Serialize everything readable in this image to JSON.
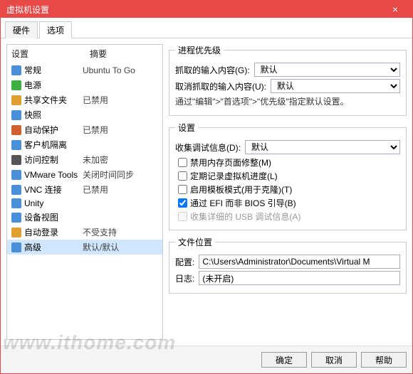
{
  "title": "虚拟机设置",
  "tabs": {
    "hardware": "硬件",
    "options": "选项"
  },
  "left": {
    "col1": "设置",
    "col2": "摘要",
    "items": [
      {
        "name": "常规",
        "summary": "Ubuntu To Go",
        "color": "#4a90d9"
      },
      {
        "name": "电源",
        "summary": "",
        "color": "#3cb043"
      },
      {
        "name": "共享文件夹",
        "summary": "已禁用",
        "color": "#e0a030"
      },
      {
        "name": "快照",
        "summary": "",
        "color": "#4a90d9"
      },
      {
        "name": "自动保护",
        "summary": "已禁用",
        "color": "#d06030"
      },
      {
        "name": "客户机隔离",
        "summary": "",
        "color": "#4a90d9"
      },
      {
        "name": "访问控制",
        "summary": "未加密",
        "color": "#555"
      },
      {
        "name": "VMware Tools",
        "summary": "关闭时间同步",
        "color": "#4a90d9"
      },
      {
        "name": "VNC 连接",
        "summary": "已禁用",
        "color": "#4a90d9"
      },
      {
        "name": "Unity",
        "summary": "",
        "color": "#4a90d9"
      },
      {
        "name": "设备视图",
        "summary": "",
        "color": "#4a90d9"
      },
      {
        "name": "自动登录",
        "summary": "不受支持",
        "color": "#e0a030"
      },
      {
        "name": "高级",
        "summary": "默认/默认",
        "color": "#4a90d9",
        "sel": true
      }
    ]
  },
  "priority": {
    "legend": "进程优先级",
    "grabbed": "抓取的输入内容(G):",
    "ungrabbed": "取消抓取的输入内容(U):",
    "val": "默认",
    "hint": "通过\"编辑\">\"首选项\">\"优先级\"指定默认设置。"
  },
  "settings": {
    "legend": "设置",
    "debug": "收集调试信息(D):",
    "debug_val": "默认",
    "cb1": "禁用内存页面修整(M)",
    "cb2": "定期记录虚拟机进度(L)",
    "cb3": "启用模板模式(用于克隆)(T)",
    "cb4": "通过 EFI 而非 BIOS 引导(B)",
    "cb5": "收集详细的 USB 调试信息(A)"
  },
  "fileloc": {
    "legend": "文件位置",
    "config": "配置:",
    "config_val": "C:\\Users\\Administrator\\Documents\\Virtual M",
    "log": "日志:",
    "log_val": "(未开启)"
  },
  "buttons": {
    "ok": "确定",
    "cancel": "取消",
    "help": "帮助"
  },
  "watermark": "www.ithome.com"
}
